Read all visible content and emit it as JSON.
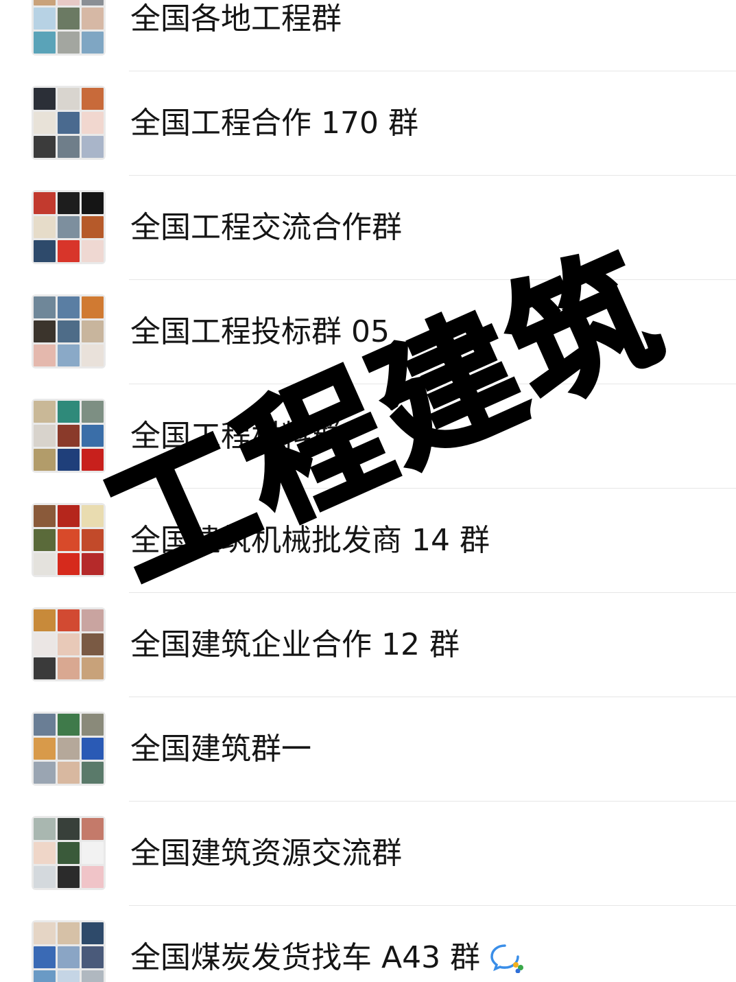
{
  "groups": [
    {
      "name": "全国各地工程群",
      "tiles": [
        "#c9a27a",
        "#e7c9c6",
        "#8a8f95",
        "#b7d2e4",
        "#6b7a63",
        "#d6b8a5",
        "#5aa3b8",
        "#a3a6a0",
        "#7fa6c3"
      ]
    },
    {
      "name": "全国工程合作 170 群",
      "tiles": [
        "#2b2f37",
        "#d9d5cf",
        "#c86a3a",
        "#e8e2d8",
        "#4a6a8f",
        "#f1d7cf",
        "#3b3b3b",
        "#6f7e8a",
        "#a9b5c9"
      ]
    },
    {
      "name": "全国工程交流合作群",
      "tiles": [
        "#c23a2e",
        "#1d1d1d",
        "#151515",
        "#e6dcc9",
        "#7d8f9e",
        "#b65a2a",
        "#2e4a6b",
        "#d8352a",
        "#efd8d2"
      ]
    },
    {
      "name": "全国工程投标群 05",
      "tiles": [
        "#6f8799",
        "#5a7ea3",
        "#d07a32",
        "#3b342c",
        "#4e6c88",
        "#c8b59d",
        "#e4b8ad",
        "#8aa9c7",
        "#e9e1da"
      ]
    },
    {
      "name": "全国工程材料群",
      "tiles": [
        "#c9b897",
        "#2f8a7a",
        "#7d8f83",
        "#d8d3cc",
        "#8a3a2a",
        "#3a6ea8",
        "#b29c6a",
        "#1f3f7a",
        "#c8201c"
      ]
    },
    {
      "name": "全国建筑机械批发商 14 群",
      "tiles": [
        "#8a5a3a",
        "#b5261c",
        "#e9dcb0",
        "#5a6a3a",
        "#d84a2a",
        "#c24a2a",
        "#e4e2dd",
        "#d62a1c",
        "#b52a2a"
      ]
    },
    {
      "name": "全国建筑企业合作 12 群",
      "tiles": [
        "#c88a3a",
        "#d24a32",
        "#c9a4a0",
        "#ebe6e4",
        "#e8c9b8",
        "#7a5a44",
        "#3a3a3a",
        "#d9a891",
        "#c8a27a"
      ]
    },
    {
      "name": "全国建筑群一",
      "tiles": [
        "#6a7e95",
        "#3f7a4a",
        "#8a8a7a",
        "#d89a4a",
        "#b5a89a",
        "#2a5ab5",
        "#9aa5b2",
        "#d8b8a0",
        "#5a7a6a"
      ]
    },
    {
      "name": "全国建筑资源交流群",
      "tiles": [
        "#a9b7b0",
        "#38403a",
        "#c47a6a",
        "#efd6c8",
        "#3a5a3a",
        "#f2f2f2",
        "#d4d9dd",
        "#2b2b2b",
        "#f0c4c8"
      ]
    },
    {
      "name": "全国煤炭发货找车 A43 群",
      "tiles": [
        "#e5d5c5",
        "#d6c1a7",
        "#2e4a6a",
        "#3a6ab5",
        "#8aa5c5",
        "#4a5a7a",
        "#6a9ac5",
        "#c5d5e5",
        "#b0b8c0"
      ],
      "icon": "wecom-chat-icon"
    }
  ],
  "watermark": {
    "text": "工程建筑"
  }
}
